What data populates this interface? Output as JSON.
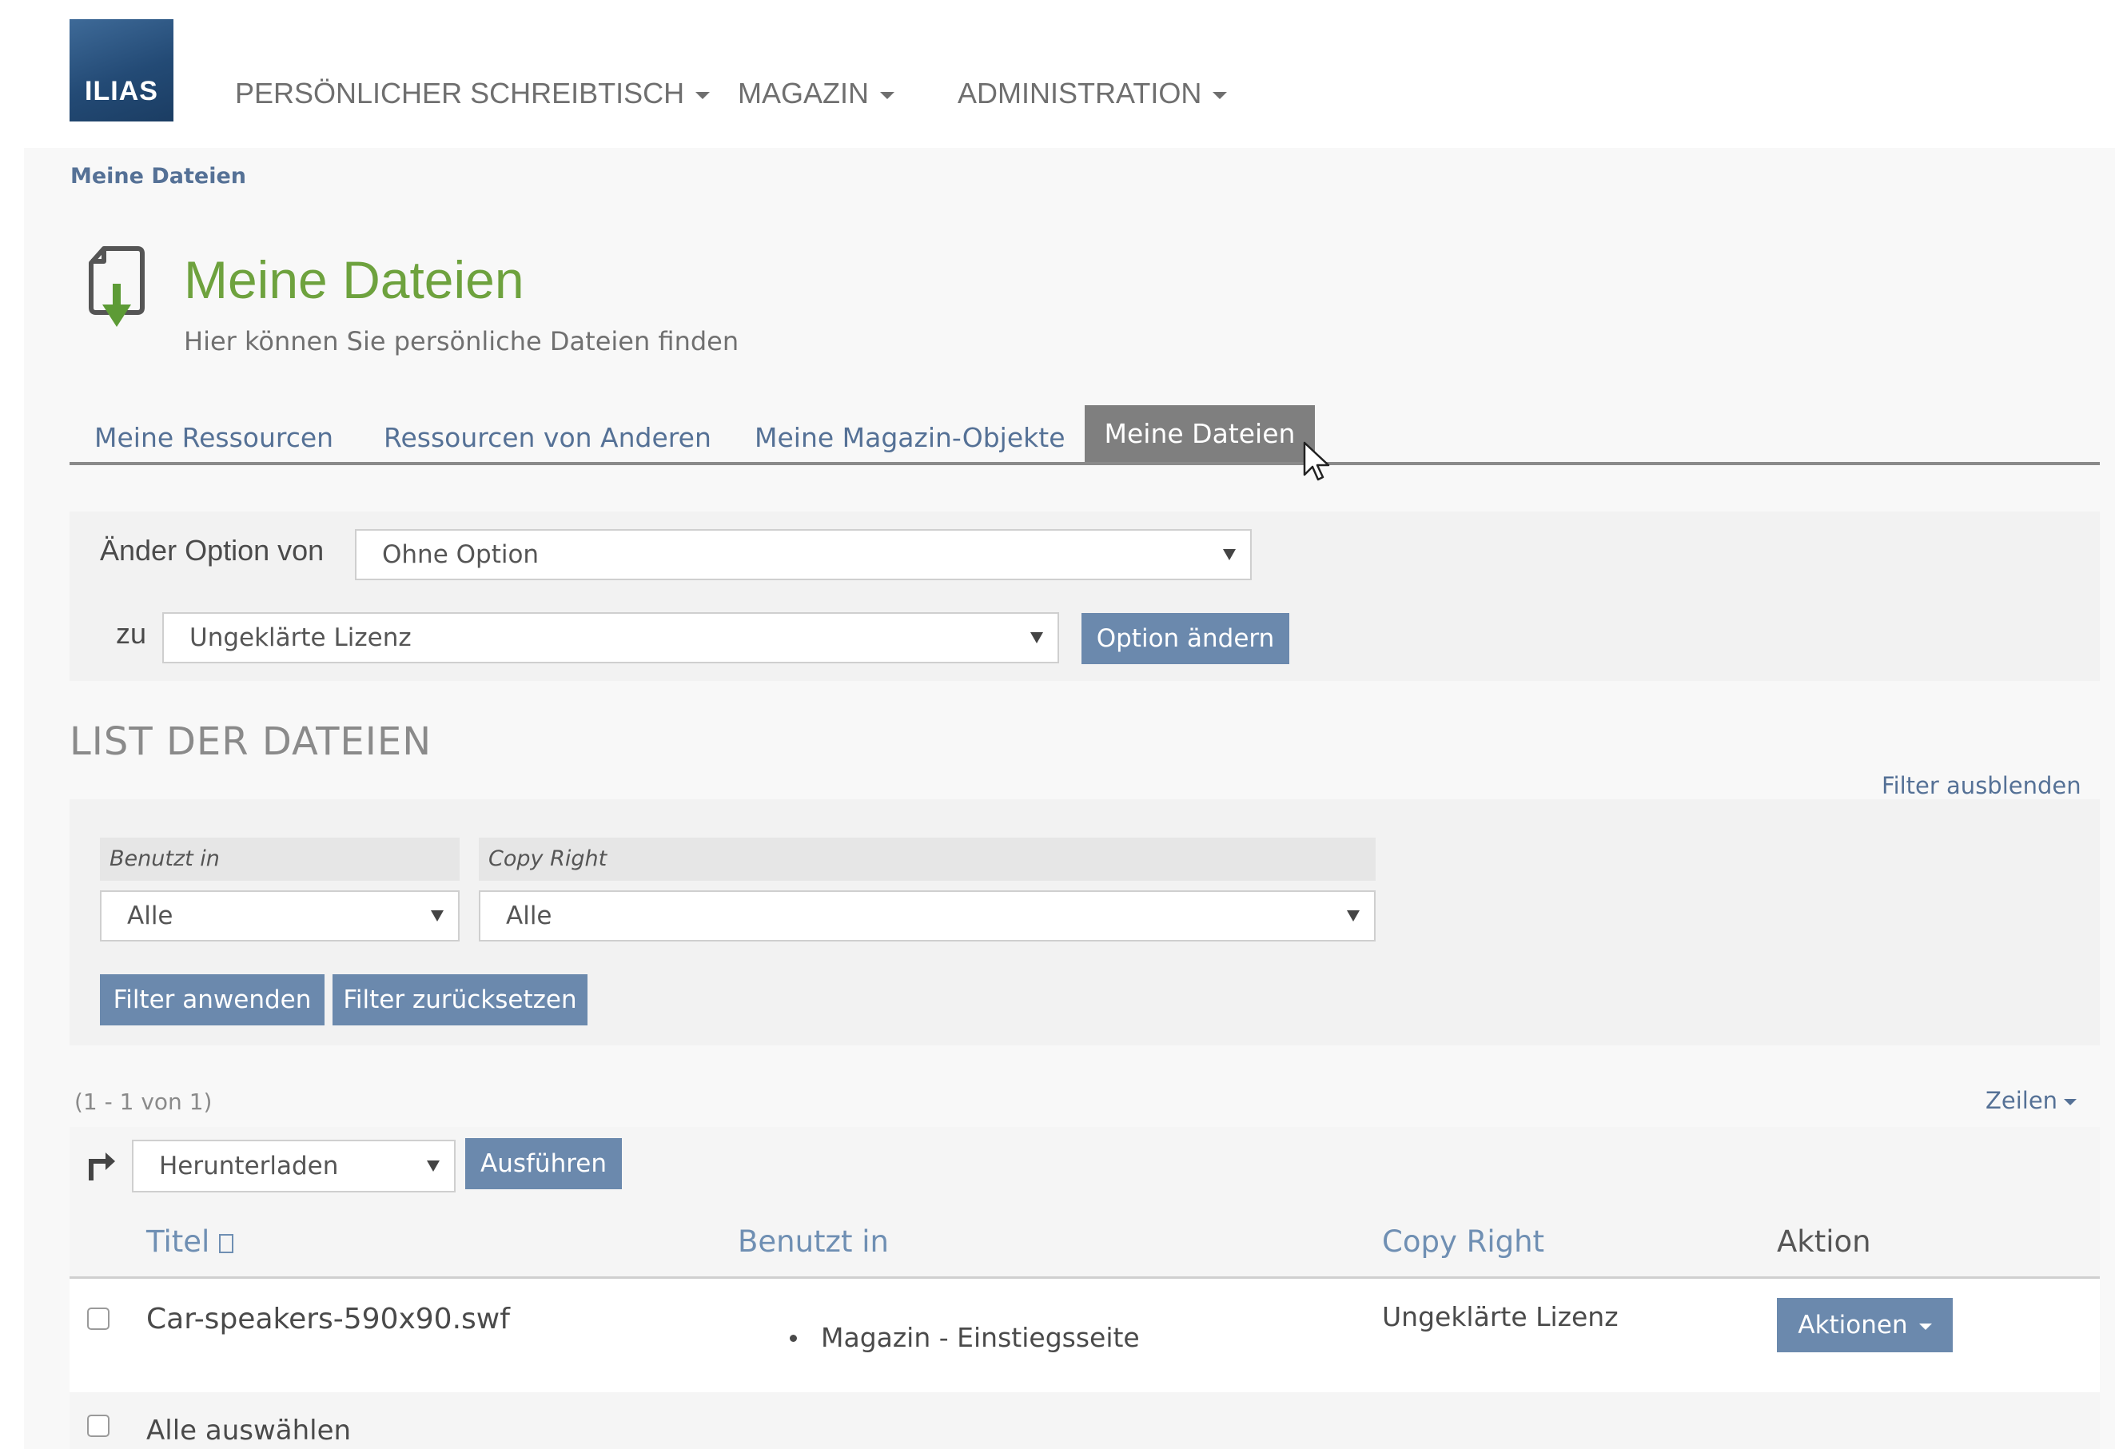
{
  "header": {
    "logo_text": "ILIAS",
    "menu": [
      "PERSÖNLICHER SCHREIBTISCH",
      "MAGAZIN",
      "ADMINISTRATION"
    ]
  },
  "breadcrumb": "Meine Dateien",
  "page": {
    "title": "Meine Dateien",
    "subtitle": "Hier können Sie persönliche Dateien finden"
  },
  "tabs": [
    "Meine Ressourcen",
    "Ressourcen von Anderen",
    "Meine Magazin-Objekte",
    "Meine Dateien"
  ],
  "change_option": {
    "from_label": "Änder Option von",
    "from_value": "Ohne Option",
    "to_label": "zu",
    "to_value": "Ungeklärte Lizenz",
    "button": "Option ändern"
  },
  "list": {
    "title": "LIST DER DATEIEN",
    "filter_toggle": "Filter ausblenden",
    "filters": [
      {
        "label": "Benutzt in",
        "value": "Alle"
      },
      {
        "label": "Copy Right",
        "value": "Alle"
      }
    ],
    "apply_button": "Filter anwenden",
    "reset_button": "Filter zurücksetzen",
    "count": "(1 - 1 von 1)",
    "rows_menu": "Zeilen",
    "action_select": "Herunterladen",
    "execute_button": "Ausführen",
    "columns": [
      "Titel",
      "Benutzt in",
      "Copy Right",
      "Aktion"
    ],
    "rows": [
      {
        "title": "Car-speakers-590x90.swf",
        "used_in": "Magazin - Einstiegsseite",
        "copyright": "Ungeklärte Lizenz",
        "action": "Aktionen"
      }
    ],
    "select_all": "Alle auswählen"
  }
}
